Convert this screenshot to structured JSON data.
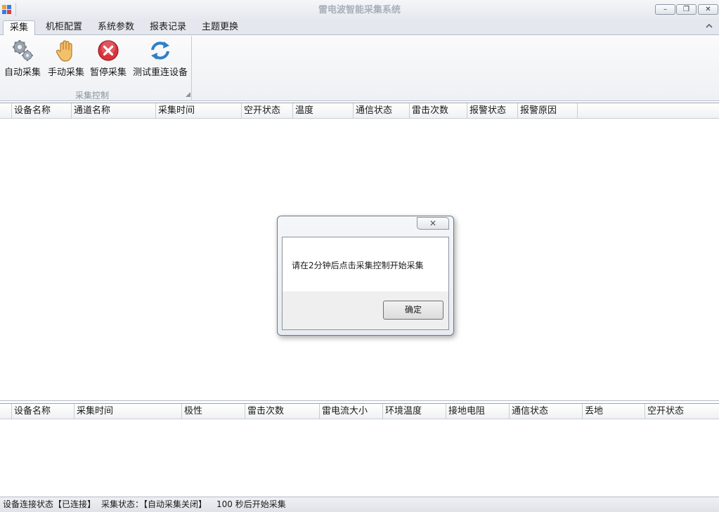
{
  "window": {
    "title": "雷电波智能采集系统",
    "minimize": "–",
    "restore": "❐",
    "close": "✕"
  },
  "tabs": [
    "采集",
    "机柜配置",
    "系统参数",
    "报表记录",
    "主题更换"
  ],
  "ribbon": {
    "buttons": [
      {
        "label": "自动采集",
        "icon": "gears-icon"
      },
      {
        "label": "手动采集",
        "icon": "hand-icon"
      },
      {
        "label": "暂停采集",
        "icon": "stop-icon"
      },
      {
        "label": "测试重连设备",
        "icon": "refresh-icon"
      }
    ],
    "group_label": "采集控制"
  },
  "top_grid": {
    "columns": [
      "设备名称",
      "通道名称",
      "采集时间",
      "空开状态",
      "温度",
      "通信状态",
      "雷击次数",
      "报警状态",
      "报警原因"
    ]
  },
  "bottom_grid": {
    "columns": [
      "设备名称",
      "采集时间",
      "极性",
      "雷击次数",
      "雷电流大小",
      "环境温度",
      "接地电阻",
      "通信状态",
      "丢地",
      "空开状态"
    ]
  },
  "status": {
    "connection": "设备连接状态【已连接】",
    "collect": "采集状态：【自动采集关闭】",
    "countdown": "100 秒后开始采集"
  },
  "dialog": {
    "close": "✕",
    "message": "请在2分钟后点击采集控制开始采集",
    "ok": "确定"
  }
}
